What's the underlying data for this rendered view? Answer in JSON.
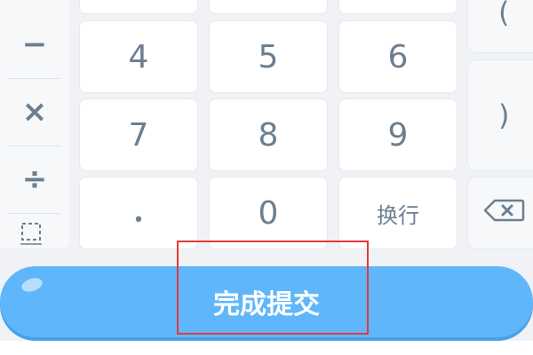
{
  "operators": {
    "minus": "−",
    "times": "×",
    "divide": "÷",
    "box_icon": "dashed-box-icon"
  },
  "keys": {
    "k4": "4",
    "k5": "5",
    "k6": "6",
    "k7": "7",
    "k8": "8",
    "k9": "9",
    "dot": "•",
    "k0": "0",
    "newline": "换行"
  },
  "right": {
    "open_paren": "(",
    "close_paren": ")",
    "backspace_icon": "backspace-icon"
  },
  "submit": {
    "label": "完成提交"
  },
  "colors": {
    "accent": "#5fb6fa",
    "key_text": "#6c7f91",
    "highlight": "#e53935"
  }
}
